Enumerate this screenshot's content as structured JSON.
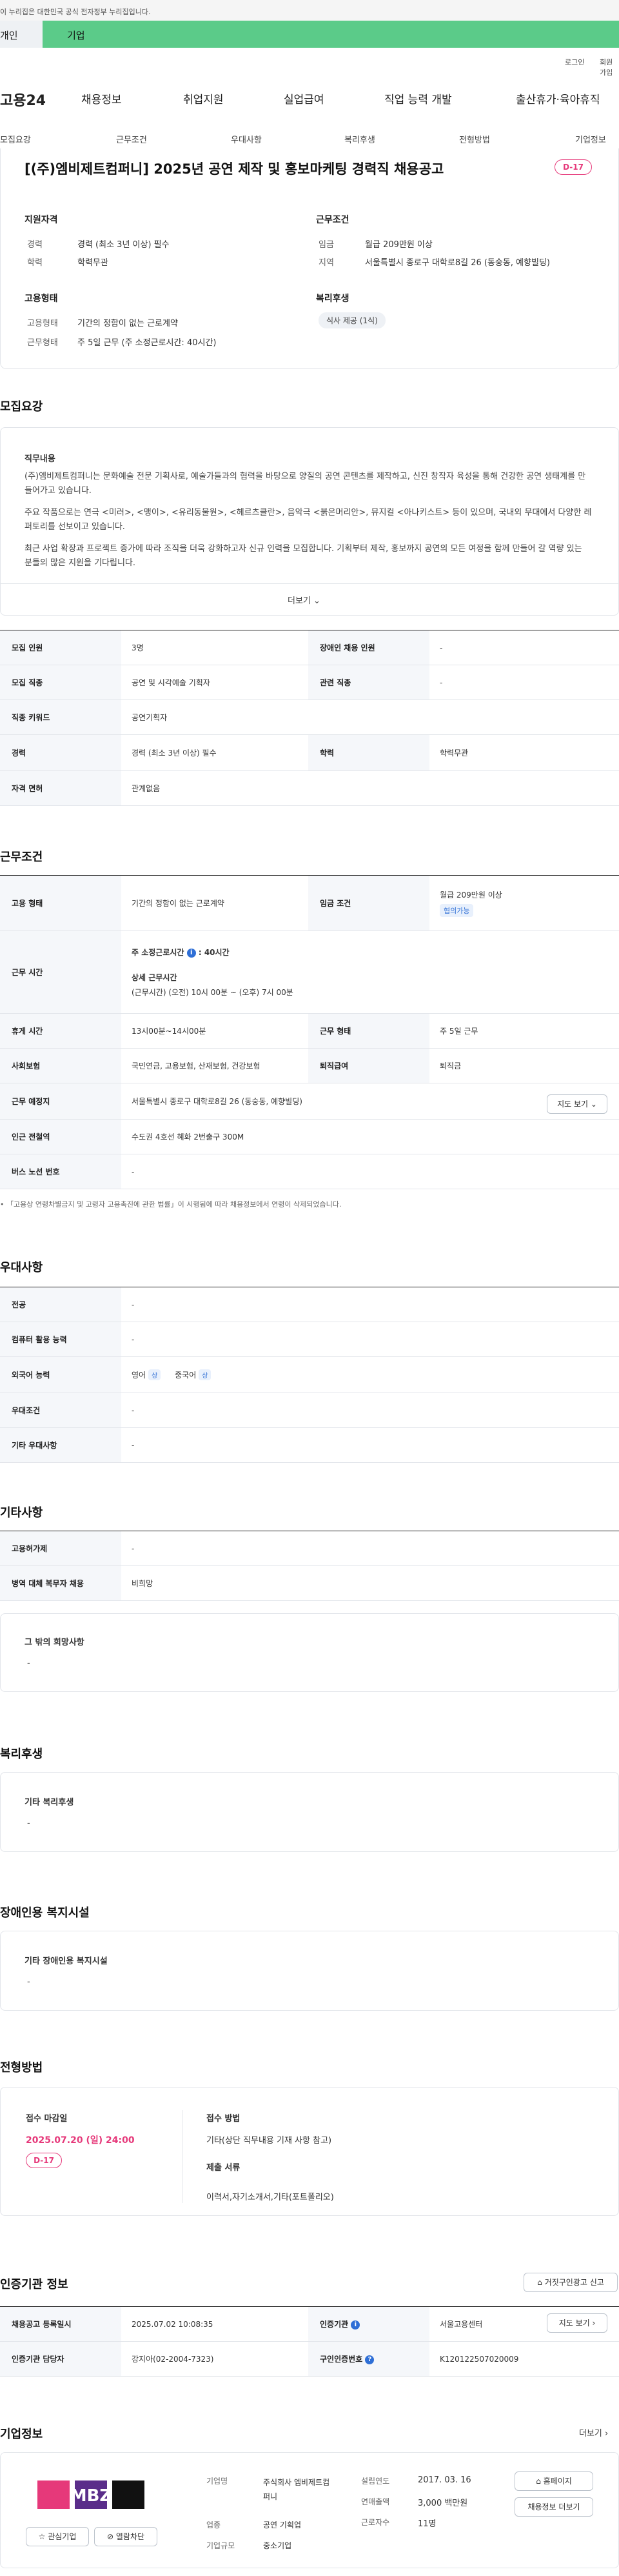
{
  "gov_banner": "이 누리집은 대한민국 공식 전자정부 누리집입니다.",
  "tabs": [
    "개인",
    "기업"
  ],
  "util": {
    "login": "로그인",
    "signup": "회원가입"
  },
  "logo": "고용24",
  "main_nav": [
    "채용정보",
    "취업지원",
    "실업급여",
    "직업 능력 개발",
    "출산휴가·육아휴직"
  ],
  "sub_nav": [
    "모집요강",
    "근무조건",
    "우대사항",
    "복리후생",
    "전형방법",
    "기업정보"
  ],
  "job": {
    "title": "[(주)엠비제트컴퍼니] 2025년 공연 제작 및 홍보마케팅 경력직 채용공고",
    "dday": "D-17",
    "qual_head": "지원자격",
    "qual": [
      {
        "label": "경력",
        "value": "경력 (최소 3년 이상) 필수"
      },
      {
        "label": "학력",
        "value": "학력무관"
      }
    ],
    "cond_head": "근무조건",
    "cond": [
      {
        "label": "임금",
        "value": "월급 209만원 이상"
      },
      {
        "label": "지역",
        "value": "서울특별시 종로구 대학로8길 26 (동숭동, 예향빌딩)"
      }
    ],
    "emp_head": "고용형태",
    "emp": [
      {
        "label": "고용형태",
        "value": "기간의 정함이 없는 근로계약"
      },
      {
        "label": "근무형태",
        "value": "주 5일 근무 (주 소정근로시간: 40시간)"
      }
    ],
    "welfare_head": "복리후생",
    "welfare_chip": "식사 제공 (1식)"
  },
  "recruit": {
    "heading": "모집요강",
    "duty_head": "직무내용",
    "paragraphs": [
      "(주)엠비제트컴퍼니는 문화예술 전문 기획사로, 예술가들과의 협력을 바탕으로 양질의 공연 콘텐츠를 제작하고, 신진 창작자 육성을 통해 건강한 공연 생태계를 만들어가고 있습니다.",
      "주요 작품으로는 연극 <미러>, <맹이>, <유리동물원>, <헤르츠클란>, 음악극 <붉은머리안>, 뮤지컬 <아나키스트> 등이 있으며, 국내외 무대에서 다양한 레퍼토리를 선보이고 있습니다.",
      "최근 사업 확장과 프로젝트 증가에 따라 조직을 더욱 강화하고자 신규 인력을 모집합니다. 기획부터 제작, 홍보까지 공연의 모든 여정을 함께 만들어 갈 역량 있는 분들의 많은 지원을 기다립니다."
    ],
    "more": "더보기",
    "table": [
      [
        "모집 인원",
        "3명",
        "장애인 채용 인원",
        "-"
      ],
      [
        "모집 직종",
        "공연 및 시각예술 기획자",
        "관련 직종",
        "-"
      ],
      [
        "직종 키워드",
        "공연기획자"
      ],
      [
        "경력",
        "경력 (최소 3년 이상) 필수",
        "학력",
        "학력무관"
      ],
      [
        "자격 면허",
        "관계없음"
      ]
    ]
  },
  "work": {
    "heading": "근무조건",
    "rows": {
      "emp_type": {
        "label": "고용 형태",
        "value": "기간의 정함이 없는 근로계약"
      },
      "wage": {
        "label": "임금 조건",
        "value": "월급 209만원 이상",
        "badge": "협의가능"
      },
      "hours": {
        "label": "근무 시간",
        "weekly_label": "주 소정근로시간",
        "weekly_value": ": 40시간",
        "detail_head": "상세 근무시간",
        "detail": "(근무시간) (오전) 10시 00분 ~ (오후) 7시 00분"
      },
      "break": {
        "label": "휴게 시간",
        "value": "13시00분~14시00분"
      },
      "work_form": {
        "label": "근무 형태",
        "value": "주 5일 근무"
      },
      "insurance": {
        "label": "사회보험",
        "value": "국민연금, 고용보험, 산재보험, 건강보험"
      },
      "severance": {
        "label": "퇴직급여",
        "value": "퇴직금"
      },
      "location": {
        "label": "근무 예정지",
        "value": "서울특별시 종로구 대학로8길 26 (동숭동, 예향빌딩)",
        "button": "지도 보기"
      },
      "subway": {
        "label": "인근 전철역",
        "value": "수도권 4호선 혜화 2번출구 300M"
      },
      "bus": {
        "label": "버스 노선 번호",
        "value": "-"
      }
    },
    "note": "「고용상 연령차별금지 및 고령자 고용촉진에 관한 법률」이 시행됨에 따라 채용정보에서 연령이 삭제되었습니다."
  },
  "prefer": {
    "heading": "우대사항",
    "rows": [
      {
        "label": "전공",
        "value": "-"
      },
      {
        "label": "컴퓨터 활용 능력",
        "value": "-"
      },
      {
        "label": "외국어 능력",
        "langs": [
          {
            "name": "영어",
            "tag": "상"
          },
          {
            "name": "중국어",
            "tag": "상"
          }
        ]
      },
      {
        "label": "우대조건",
        "value": "-"
      },
      {
        "label": "기타 우대사항",
        "value": "-"
      }
    ]
  },
  "etc": {
    "heading": "기타사항",
    "rows": [
      {
        "label": "고용허가제",
        "value": "-"
      },
      {
        "label": "병역 대체 복무자 채용",
        "value": "비희망"
      }
    ],
    "other_head": "그 밖의 희망사항",
    "other_value": "-"
  },
  "welfare": {
    "heading": "복리후생",
    "sub": "기타 복리후생",
    "value": "-"
  },
  "disabled": {
    "heading": "장애인용 복지시설",
    "sub": "기타 장애인용 복지시설",
    "value": "-"
  },
  "screening": {
    "heading": "전형방법",
    "deadline_label": "접수 마감일",
    "deadline": "2025.07.20 (일) 24:00",
    "dday": "D-17",
    "method_label": "접수 방법",
    "method_value": "기타(상단 직무내용 기재 사항 참고)",
    "docs_label": "제출 서류",
    "docs_value": "이력서,자기소개서,기타(포트폴리오)"
  },
  "cert": {
    "heading": "인증기관 정보",
    "report_btn": "거짓구인광고 신고",
    "rows": [
      [
        "채용공고 등록일시",
        "2025.07.02 10:08:35",
        "인증기관",
        "서울고용센터"
      ],
      [
        "인증기관 담당자",
        "강지아(02-2004-7323)",
        "구인인증번호",
        "K120122507020009"
      ]
    ],
    "map_btn": "지도 보기"
  },
  "company": {
    "heading": "기업정보",
    "more": "더보기",
    "logo_text": "MBZ",
    "fav_btn": "관심기업",
    "block_btn": "열람차단",
    "name_label": "기업명",
    "name_value": "주식회사 엠비제트컴퍼니",
    "type_label": "업종",
    "type_value": "공연 기획업",
    "size_label": "기업규모",
    "size_value": "중소기업",
    "founded_label": "설립연도",
    "founded_value": "2017. 03. 16",
    "sales_label": "연매출액",
    "sales_value": "3,000 백만원",
    "emp_label": "근로자수",
    "emp_value": "11명",
    "home_btn": "홈페이지",
    "jobs_btn": "채용정보 더보기"
  },
  "colors": {
    "accent_green": "#5bcb89",
    "dday_pink": "#e6397a",
    "info_blue": "#2f6fd6"
  }
}
